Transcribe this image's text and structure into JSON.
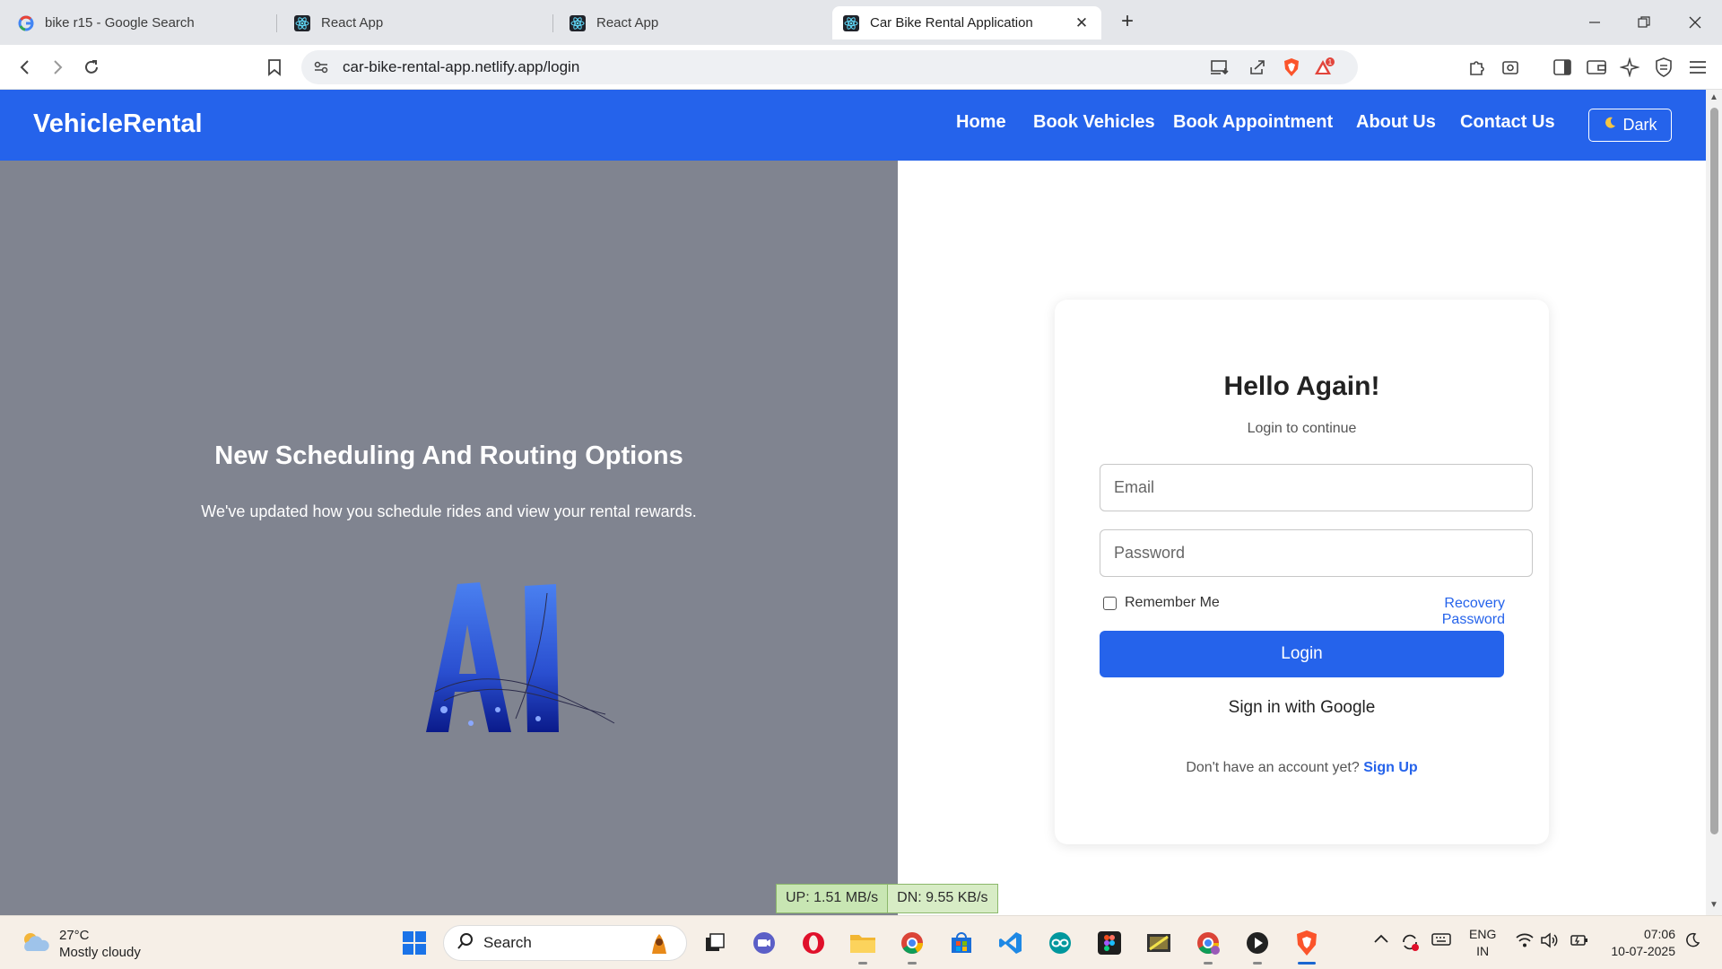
{
  "browser": {
    "tabs": [
      {
        "title": "bike r15 - Google Search",
        "icon": "google-icon",
        "active": false
      },
      {
        "title": "React App",
        "icon": "react-icon",
        "active": false
      },
      {
        "title": "React App",
        "icon": "react-icon",
        "active": false
      },
      {
        "title": "Car Bike Rental Application",
        "icon": "react-icon",
        "active": true
      }
    ],
    "url": "car-bike-rental-app.netlify.app/login",
    "notification_count": "1"
  },
  "navbar": {
    "brand": "VehicleRental",
    "links": [
      "Home",
      "Book Vehicles",
      "Book Appointment",
      "About Us",
      "Contact Us"
    ],
    "theme_button": "Dark",
    "color": "#2563eb"
  },
  "promo": {
    "title": "New Scheduling And Routing Options",
    "subtitle": "We've updated how you schedule rides and view your rental rewards.",
    "art_text": "AI"
  },
  "login": {
    "title": "Hello Again!",
    "subtitle": "Login to continue",
    "email_placeholder": "Email",
    "password_placeholder": "Password",
    "remember_label": "Remember Me",
    "recovery_link": "Recovery Password",
    "login_button": "Login",
    "google_button": "Sign in with Google",
    "signup_prompt": "Don't have an account yet?",
    "signup_link": "Sign Up"
  },
  "netspeed": {
    "up": "UP: 1.51 MB/s",
    "down": "DN: 9.55 KB/s"
  },
  "taskbar": {
    "weather_temp": "27°C",
    "weather_desc": "Mostly cloudy",
    "search_label": "Search",
    "language": "ENG",
    "region": "IN",
    "time": "07:06",
    "date": "10-07-2025"
  }
}
